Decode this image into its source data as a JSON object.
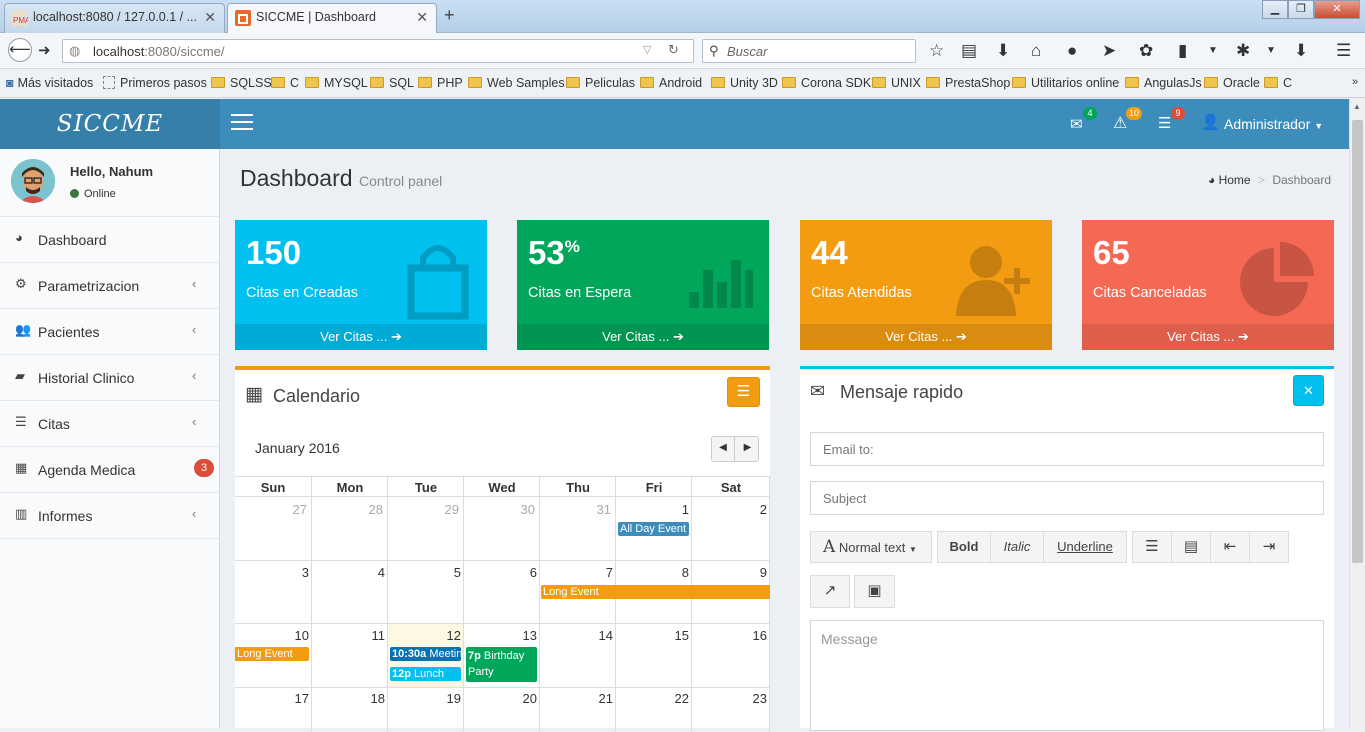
{
  "browser": {
    "tabs": [
      {
        "title": "localhost:8080 / 127.0.0.1 / ...",
        "active": false
      },
      {
        "title": "SICCME | Dashboard",
        "active": true
      }
    ],
    "url_host": "localhost",
    "url_rest": ":8080/siccme/",
    "search_placeholder": "Buscar",
    "bookmarks": [
      "Más visitados",
      "Primeros pasos",
      "SQLSS",
      "C",
      "MYSQL",
      "SQL",
      "PHP",
      "Web Samples",
      "Peliculas",
      "Android",
      "Unity 3D",
      "Corona SDK",
      "UNIX",
      "PrestaShop",
      "Utilitarios online",
      "AngulasJs",
      "Oracle",
      "C"
    ]
  },
  "app": {
    "logo": "SICCME",
    "badges": {
      "messages": "4",
      "notifications": "10",
      "tasks": "9"
    },
    "user_menu": "Administrador"
  },
  "sidebar": {
    "greeting": "Hello, Nahum",
    "status": "Online",
    "items": [
      {
        "label": "Dashboard",
        "icon": "dashboard-icon"
      },
      {
        "label": "Parametrizacion",
        "icon": "cogs-icon"
      },
      {
        "label": "Pacientes",
        "icon": "users-icon"
      },
      {
        "label": "Historial Clinico",
        "icon": "folder-open-icon"
      },
      {
        "label": "Citas",
        "icon": "list-icon"
      },
      {
        "label": "Agenda Medica",
        "icon": "calendar-icon",
        "badge": "3"
      },
      {
        "label": "Informes",
        "icon": "bar-chart-icon"
      }
    ]
  },
  "page": {
    "title": "Dashboard",
    "subtitle": "Control panel",
    "breadcrumb_home": "Home",
    "breadcrumb_current": "Dashboard"
  },
  "stats": [
    {
      "value": "150",
      "label": "Citas en Creadas",
      "link": "Ver Citas ...",
      "color": "#00c0ef"
    },
    {
      "value": "53",
      "suffix": "%",
      "label": "Citas en Espera",
      "link": "Ver Citas ...",
      "color": "#00a65a"
    },
    {
      "value": "44",
      "label": "Citas Atendidas",
      "link": "Ver Citas ...",
      "color": "#f39c12"
    },
    {
      "value": "65",
      "label": "Citas Canceladas",
      "link": "Ver Citas ...",
      "color": "#f56954"
    }
  ],
  "calendar": {
    "title": "Calendario",
    "month": "January 2016",
    "weekdays": [
      "Sun",
      "Mon",
      "Tue",
      "Wed",
      "Thu",
      "Fri",
      "Sat"
    ],
    "weeks": [
      [
        "27",
        "28",
        "29",
        "30",
        "31",
        "1",
        "2"
      ],
      [
        "3",
        "4",
        "5",
        "6",
        "7",
        "8",
        "9"
      ],
      [
        "10",
        "11",
        "12",
        "13",
        "14",
        "15",
        "16"
      ],
      [
        "17",
        "18",
        "19",
        "20",
        "21",
        "22",
        "23"
      ]
    ],
    "events": {
      "all_day": "All Day Event",
      "long_event": "Long Event",
      "meeting_time": "10:30a",
      "meeting": "Meetin",
      "lunch_time": "12p",
      "lunch": "Lunch",
      "birthday_time": "7p",
      "birthday": "Birthday Party"
    }
  },
  "quick_message": {
    "title": "Mensaje rapido",
    "email_placeholder": "Email to:",
    "subject_placeholder": "Subject",
    "format_label": "Normal text",
    "bold": "Bold",
    "italic": "Italic",
    "underline": "Underline",
    "message_placeholder": "Message"
  }
}
